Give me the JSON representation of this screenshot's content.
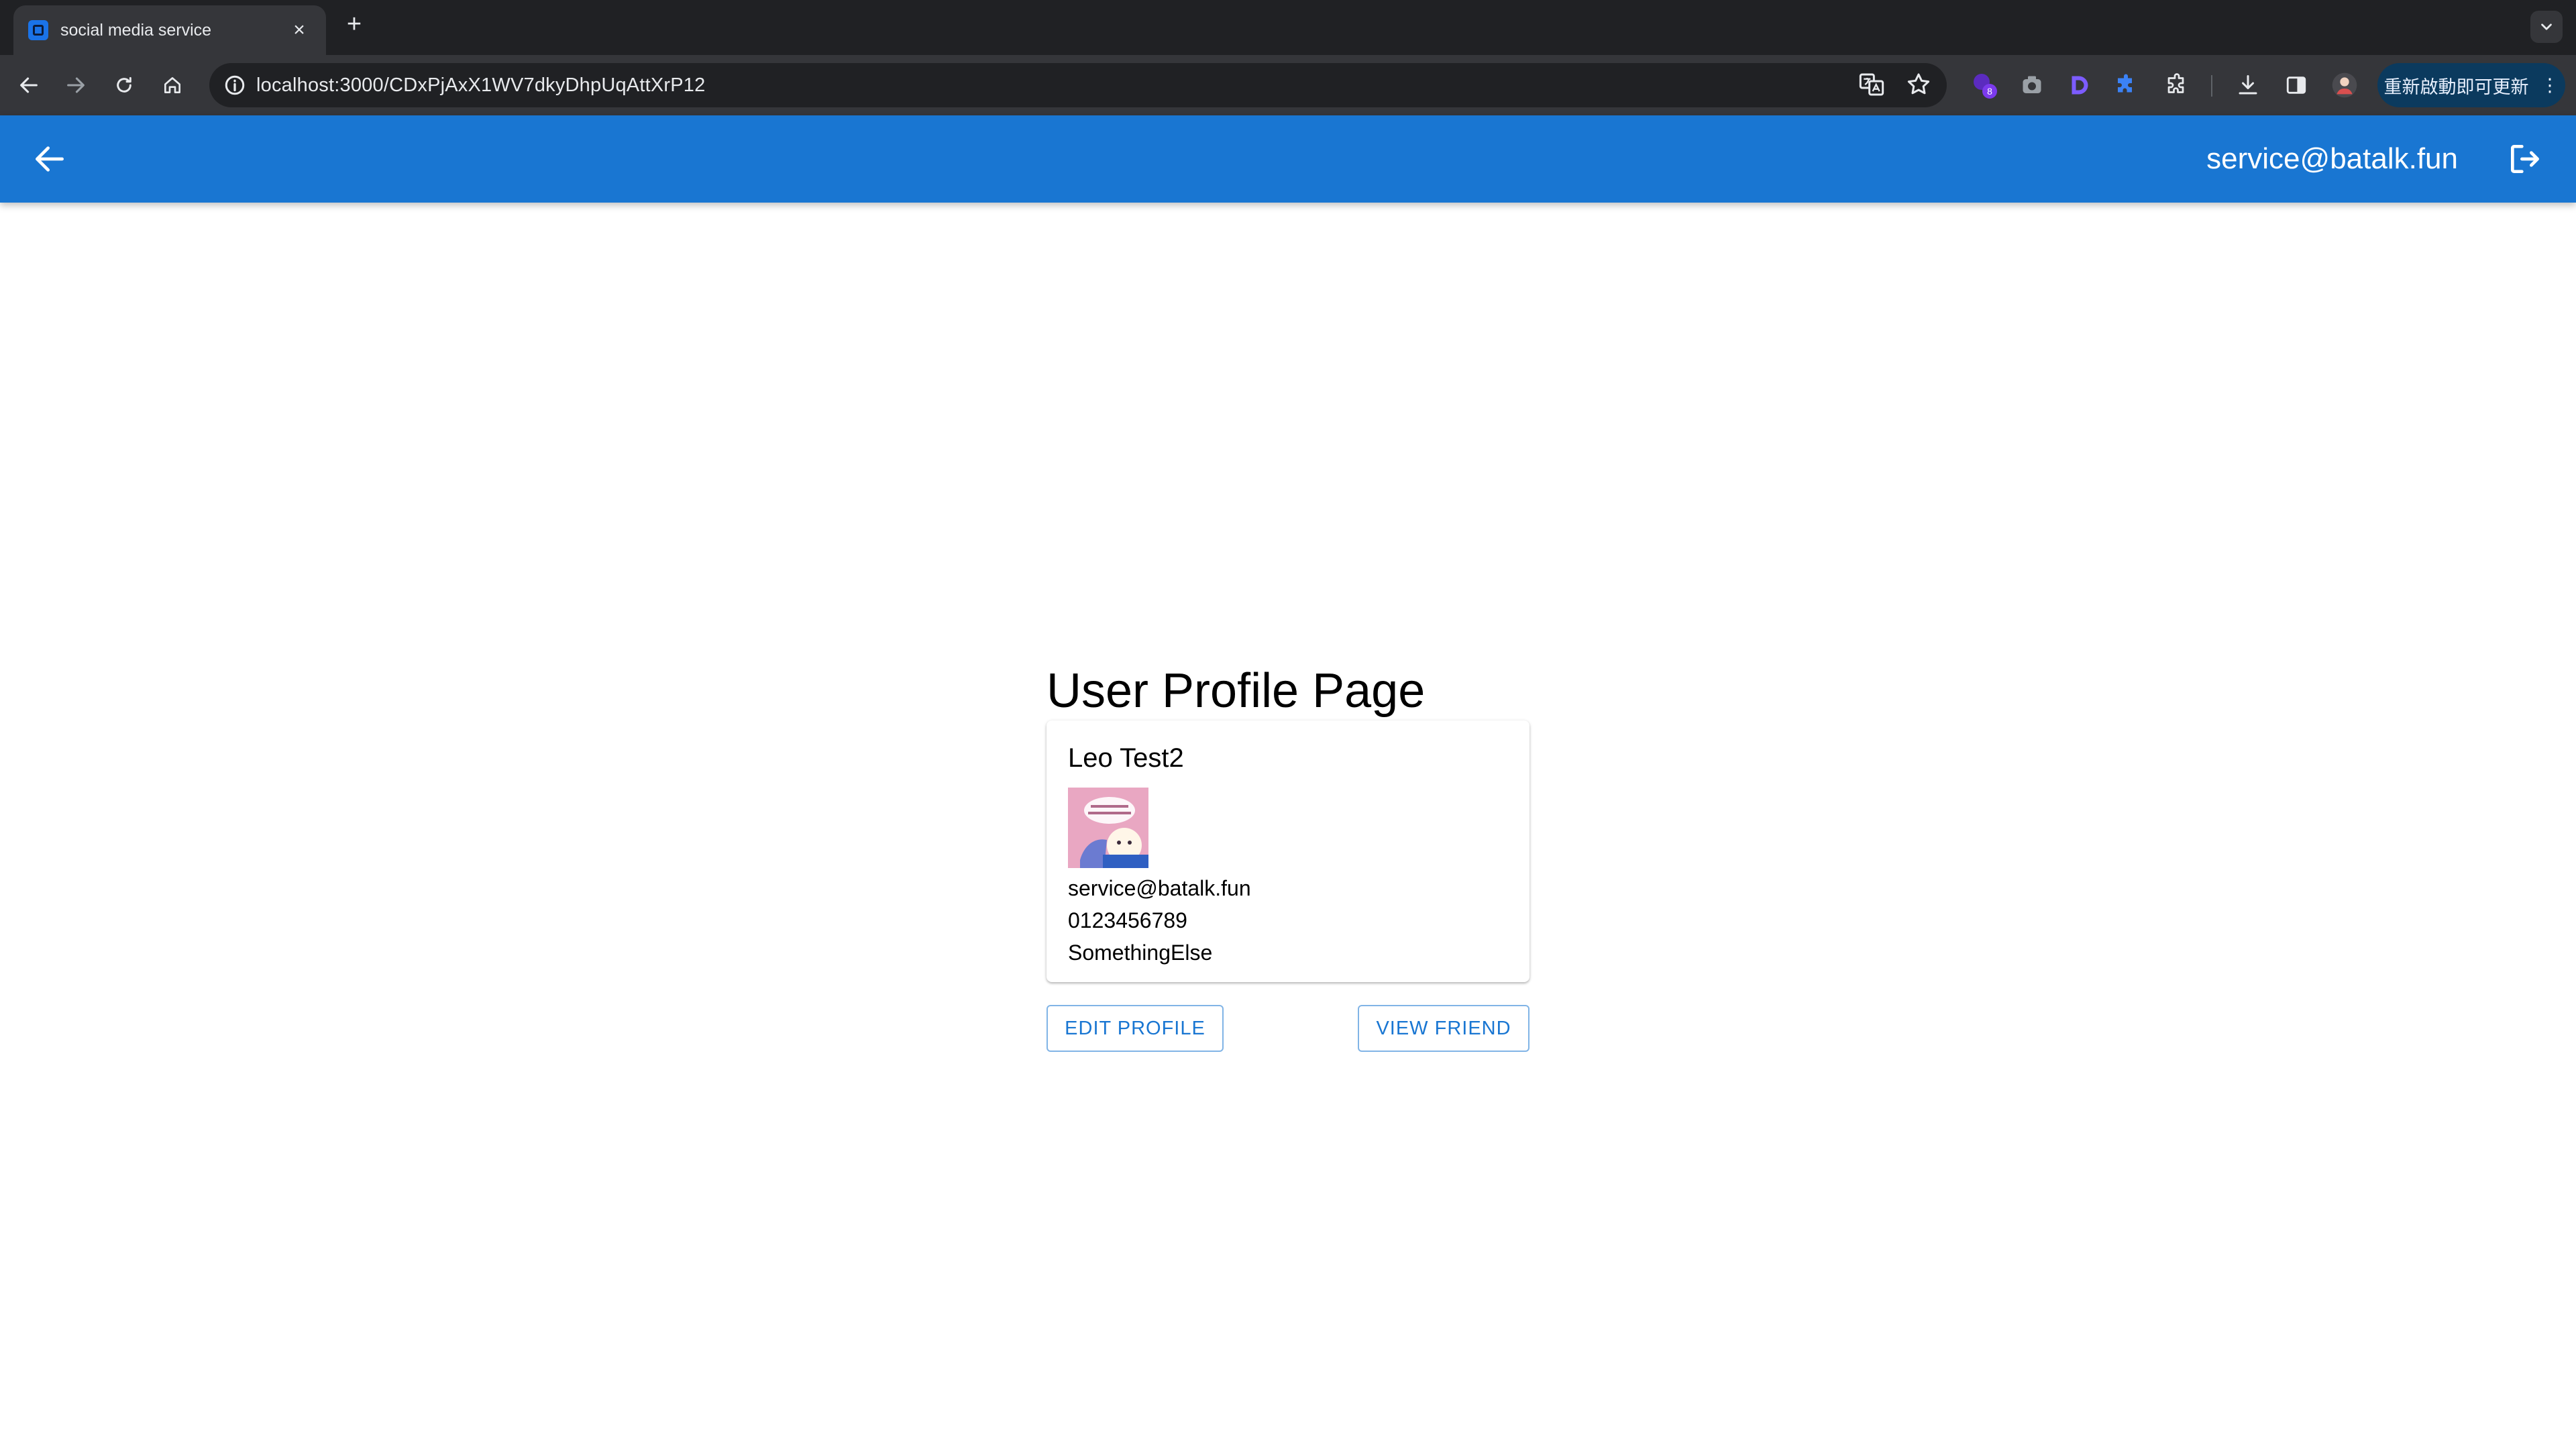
{
  "browser": {
    "tab_title": "social media service",
    "tab_close": "×",
    "new_tab": "+",
    "url": "localhost:3000/CDxPjAxX1WV7dkyDhpUqAttXrP12",
    "extension_badge": "8",
    "update_label": "重新啟動即可更新",
    "update_menu": "⋮"
  },
  "appbar": {
    "user_email": "service@batalk.fun",
    "color": "#1976d2"
  },
  "page": {
    "title": "User Profile Page"
  },
  "profile": {
    "name": "Leo Test2",
    "email": "service@batalk.fun",
    "phone": "0123456789",
    "bio": "SomethingElse"
  },
  "actions": {
    "edit_profile": "EDIT PROFILE",
    "view_friend": "VIEW FRIEND"
  }
}
